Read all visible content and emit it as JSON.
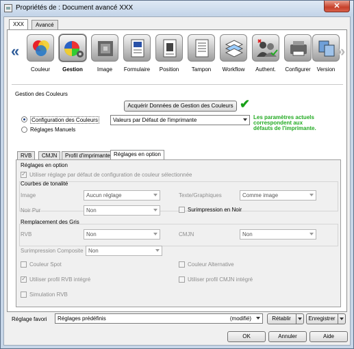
{
  "window": {
    "title": "Propriétés de : Document avancé XXX",
    "close": "✕"
  },
  "outer_tabs": [
    "XXX",
    "Avancé"
  ],
  "toolbar": {
    "prev": "«",
    "next": "»",
    "items": [
      {
        "label": "Couleur",
        "icon": "color-circles-icon"
      },
      {
        "label": "Gestion",
        "icon": "color-management-icon"
      },
      {
        "label": "Image",
        "icon": "image-icon"
      },
      {
        "label": "Formulaire",
        "icon": "form-icon"
      },
      {
        "label": "Position",
        "icon": "position-icon"
      },
      {
        "label": "Tampon",
        "icon": "stamp-icon"
      },
      {
        "label": "Workflow",
        "icon": "workflow-icon"
      },
      {
        "label": "Authent.",
        "icon": "authentication-icon"
      },
      {
        "label": "Configurer",
        "icon": "configure-icon"
      },
      {
        "label": "Version",
        "icon": "version-icon"
      }
    ]
  },
  "gestion": {
    "group_title": "Gestion des Couleurs",
    "acquire_button": "Acquérir Données de Gestion des Couleurs",
    "radio_config": "Configuration des Couleurs",
    "radio_manual": "Réglages Manuels",
    "config_select": "Valeurs par Défaut de l'imprimante",
    "status_text": [
      "Les paramètres actuels",
      "correspondent aux",
      "défauts de l'imprimante."
    ]
  },
  "inner_tabs": [
    "RVB",
    "CMJN",
    "Profil d'imprimante",
    "Réglages en option"
  ],
  "options": {
    "group_title": "Réglages en option",
    "use_default": "Utiliser réglage par défaut de configuration de couleur sélectionnée",
    "tone_title": "Courbes de tonalité",
    "image_label": "Image",
    "image_value": "Aucun réglage",
    "text_label": "Texte/Graphiques",
    "text_value": "Comme image",
    "black_label": "Noir Pur",
    "black_value": "Non",
    "overprint_black": "Surimpression en Noir",
    "gray_title": "Remplacement des Gris",
    "rvb_label": "RVB",
    "rvb_value": "Non",
    "cmjn_label": "CMJN",
    "cmjn_value": "Non",
    "composite_label": "Surimpression Composite",
    "composite_value": "Non",
    "spot": "Couleur Spot",
    "alt_color": "Couleur Alternative",
    "rvb_profile": "Utiliser profil RVB intégré",
    "cmjn_profile": "Utiliser profil CMJN intégré",
    "rvb_sim": "Simulation RVB"
  },
  "bottom": {
    "favorite_label": "Réglage favori",
    "favorite_value": "Réglages prédéfinis",
    "modified": "(modifié)",
    "restore": "Rétablir",
    "save": "Enregistrer",
    "ok": "OK",
    "cancel": "Annuler",
    "help": "Aide"
  }
}
